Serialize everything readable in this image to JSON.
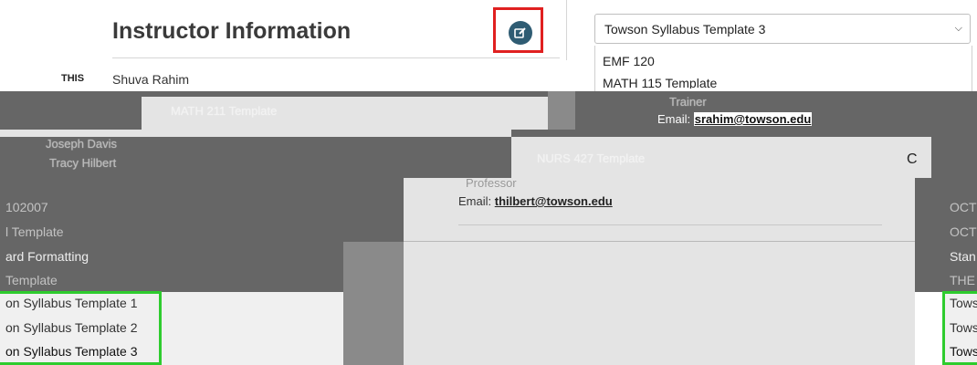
{
  "header": {
    "title": "Instructor Information",
    "edit_icon": "edit-icon",
    "highlight_color": "#e02020"
  },
  "select": {
    "value": "Towson Syllabus Template 3",
    "options_visible": [
      "EMF 120",
      "MATH 115 Template"
    ]
  },
  "instructor": {
    "label": "THIS",
    "name": "Shuva Rahim",
    "title_fragment": "Trainer",
    "email_prefix": "Email:",
    "email": "srahim@towson.edu"
  },
  "second_instructor": {
    "title_fragment": "Professor",
    "email_prefix": "Email:",
    "email": "thilbert@towson.edu"
  },
  "background_list": {
    "items": [
      "MATH 211 Template",
      "Joseph Davis",
      "Tracy Hilbert",
      "NURS 427 Template"
    ]
  },
  "template_list_left": {
    "items": [
      "102007",
      "l Template",
      "ard Formatting",
      "Template",
      "on Syllabus Template 1",
      "on Syllabus Template 2",
      "on Syllabus Template 3"
    ]
  },
  "template_list_right": {
    "items": [
      "OCT",
      "OCT",
      "Stan",
      "THE",
      "Tows",
      "Tows",
      "Tows"
    ]
  },
  "highlight_green": "#2ecc2e",
  "caret_icon": "caret-icon"
}
